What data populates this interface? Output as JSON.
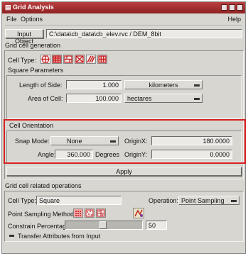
{
  "window": {
    "title": "Grid Analysis",
    "colors": {
      "titlebar": "#a03030",
      "panel": "#d8d6d0",
      "highlight": "#d42020"
    }
  },
  "menu": {
    "file": "File",
    "options": "Options",
    "help": "Help"
  },
  "input_object": {
    "button_label": "Input Object",
    "path": "C:\\data\\cb_data\\cb_elev.rvc / DEM_8bit"
  },
  "grid_cell_generation": {
    "header": "Grid cell generation",
    "cell_type_label": "Cell Type:",
    "cell_type_icons": [
      "hexagon-grid-icon",
      "square-grid-icon",
      "rectangle-grid-icon",
      "triangle-grid-icon",
      "diagonal-grid-icon",
      "diamond-grid-icon"
    ],
    "square_parameters": {
      "header": "Square Parameters",
      "length_label": "Length of Side:",
      "length_value": "1.000",
      "length_unit": "kilometers",
      "area_label": "Area of Cell:",
      "area_value": "100.000",
      "area_unit": "hectares"
    },
    "cell_orientation": {
      "header": "Cell Orientation",
      "snap_mode_label": "Snap Mode:",
      "snap_mode_value": "None",
      "origin_x_label": "OriginX:",
      "origin_x_value": "180.0000",
      "angle_label": "Angle:",
      "angle_value": "360.000",
      "angle_unit": "Degrees",
      "origin_y_label": "OriginY:",
      "origin_y_value": "0.0000"
    },
    "apply_label": "Apply"
  },
  "related_operations": {
    "header": "Grid cell related operations",
    "cell_type_label": "Cell Type:",
    "cell_type_value": "Square",
    "operation_label": "Operation:",
    "operation_value": "Point Sampling",
    "point_sampling_label": "Point Sampling Method:",
    "sampling_icons": [
      "grid-dots-icon",
      "random-dots-icon",
      "stratified-dots-icon"
    ],
    "run_icon": "sampling-run-icon",
    "constrain_label": "Constrain Percentage",
    "constrain_value": "50",
    "constrain_percent": 50,
    "transfer_label": "Transfer Attributes from Input",
    "transfer_checked": true
  }
}
